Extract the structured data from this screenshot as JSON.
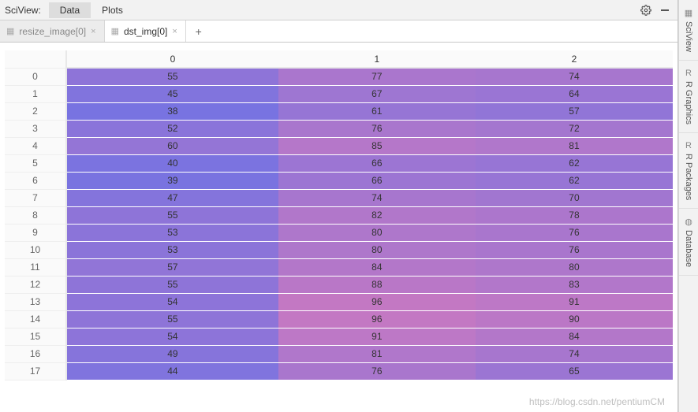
{
  "topbar": {
    "title": "SciView:",
    "subtabs": [
      {
        "label": "Data",
        "active": true
      },
      {
        "label": "Plots",
        "active": false
      }
    ]
  },
  "file_tabs": [
    {
      "label": "resize_image[0]",
      "active": false
    },
    {
      "label": "dst_img[0]",
      "active": true
    }
  ],
  "right_rail": [
    {
      "label": "SciView"
    },
    {
      "label": "R Graphics"
    },
    {
      "label": "R Packages"
    },
    {
      "label": "Database"
    }
  ],
  "table": {
    "columns": [
      "0",
      "1",
      "2"
    ],
    "rows": [
      {
        "idx": "0",
        "v": [
          55,
          77,
          74
        ]
      },
      {
        "idx": "1",
        "v": [
          45,
          67,
          64
        ]
      },
      {
        "idx": "2",
        "v": [
          38,
          61,
          57
        ]
      },
      {
        "idx": "3",
        "v": [
          52,
          76,
          72
        ]
      },
      {
        "idx": "4",
        "v": [
          60,
          85,
          81
        ]
      },
      {
        "idx": "5",
        "v": [
          40,
          66,
          62
        ]
      },
      {
        "idx": "6",
        "v": [
          39,
          66,
          62
        ]
      },
      {
        "idx": "7",
        "v": [
          47,
          74,
          70
        ]
      },
      {
        "idx": "8",
        "v": [
          55,
          82,
          78
        ]
      },
      {
        "idx": "9",
        "v": [
          53,
          80,
          76
        ]
      },
      {
        "idx": "10",
        "v": [
          53,
          80,
          76
        ]
      },
      {
        "idx": "11",
        "v": [
          57,
          84,
          80
        ]
      },
      {
        "idx": "12",
        "v": [
          55,
          88,
          83
        ]
      },
      {
        "idx": "13",
        "v": [
          54,
          96,
          91
        ]
      },
      {
        "idx": "14",
        "v": [
          55,
          96,
          90
        ]
      },
      {
        "idx": "15",
        "v": [
          54,
          91,
          84
        ]
      },
      {
        "idx": "16",
        "v": [
          49,
          81,
          74
        ]
      },
      {
        "idx": "17",
        "v": [
          44,
          76,
          65
        ]
      }
    ]
  },
  "heatmap": {
    "min": 38,
    "max": 96,
    "low_color": [
      120,
      115,
      225
    ],
    "high_color": [
      195,
      120,
      195
    ]
  },
  "watermark": "https://blog.csdn.net/pentiumCM"
}
